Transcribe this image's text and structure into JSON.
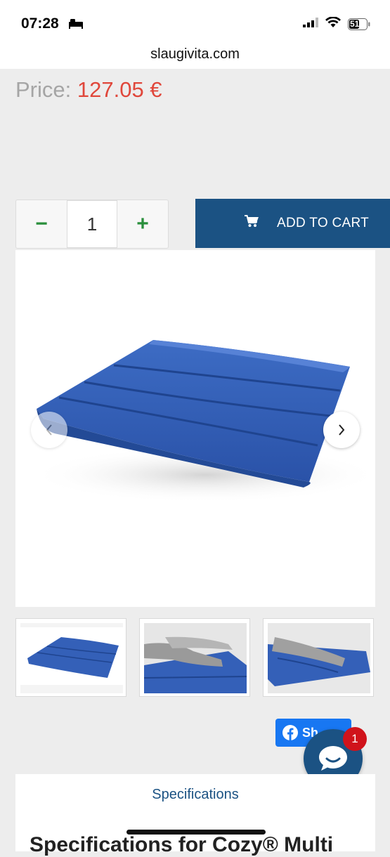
{
  "status_bar": {
    "time": "07:28",
    "battery": "51"
  },
  "browser": {
    "url": "slaugivita.com"
  },
  "product": {
    "price_label": "Price:",
    "price_value": "127.05 €"
  },
  "quantity": {
    "minus": "−",
    "value": "1",
    "plus": "+"
  },
  "add_to_cart_label": "ADD TO CART",
  "gallery": {
    "prev_icon": "chevron-left-icon",
    "next_icon": "chevron-right-icon"
  },
  "share": {
    "label": "Sh",
    "icon": "facebook-icon"
  },
  "chat": {
    "badge_count": "1"
  },
  "specifications": {
    "tab_label": "Specifications",
    "heading_partial": "Specifications for Cozy® Multi"
  },
  "colors": {
    "accent": "#1b5283",
    "price": "#e0473b",
    "plus_minus": "#2a8f3c",
    "facebook": "#1877f2",
    "badge": "#d0131b"
  }
}
